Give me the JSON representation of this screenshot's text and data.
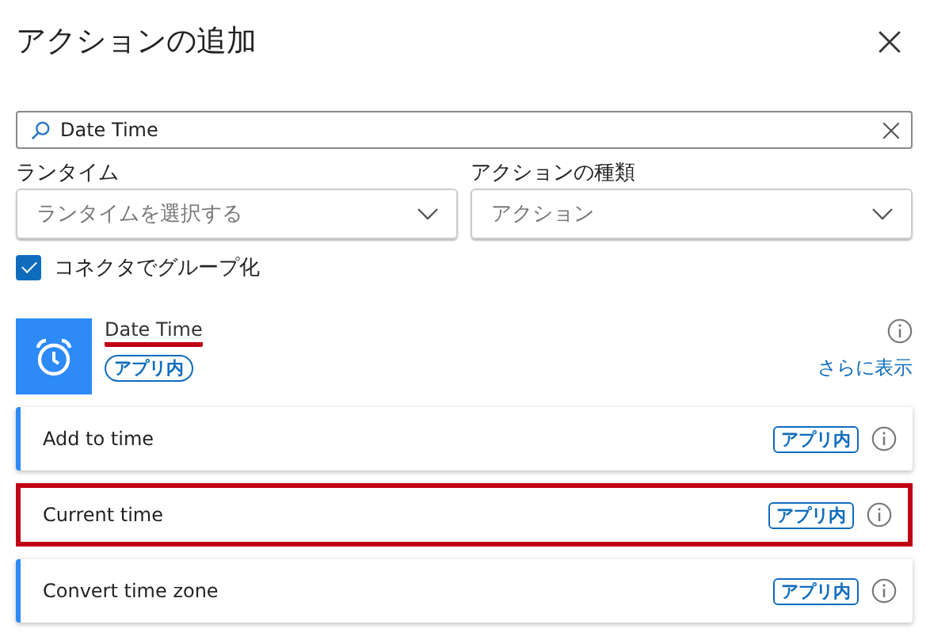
{
  "panel": {
    "title": "アクションの追加"
  },
  "search": {
    "value": "Date Time"
  },
  "filters": [
    {
      "label": "ランタイム",
      "placeholder": "ランタイムを選択する"
    },
    {
      "label": "アクションの種類",
      "value": "アクション"
    }
  ],
  "group_by_connector": {
    "label": "コネクタでグループ化",
    "checked": true
  },
  "connector": {
    "name": "Date Time",
    "underlined": true,
    "badge": "アプリ内",
    "more_link": "さらに表示"
  },
  "actions": [
    {
      "name": "Add to time",
      "badge": "アプリ内",
      "highlighted": false
    },
    {
      "name": "Current time",
      "badge": "アプリ内",
      "highlighted": true
    },
    {
      "name": "Convert time zone",
      "badge": "アプリ内",
      "highlighted": false
    }
  ]
}
